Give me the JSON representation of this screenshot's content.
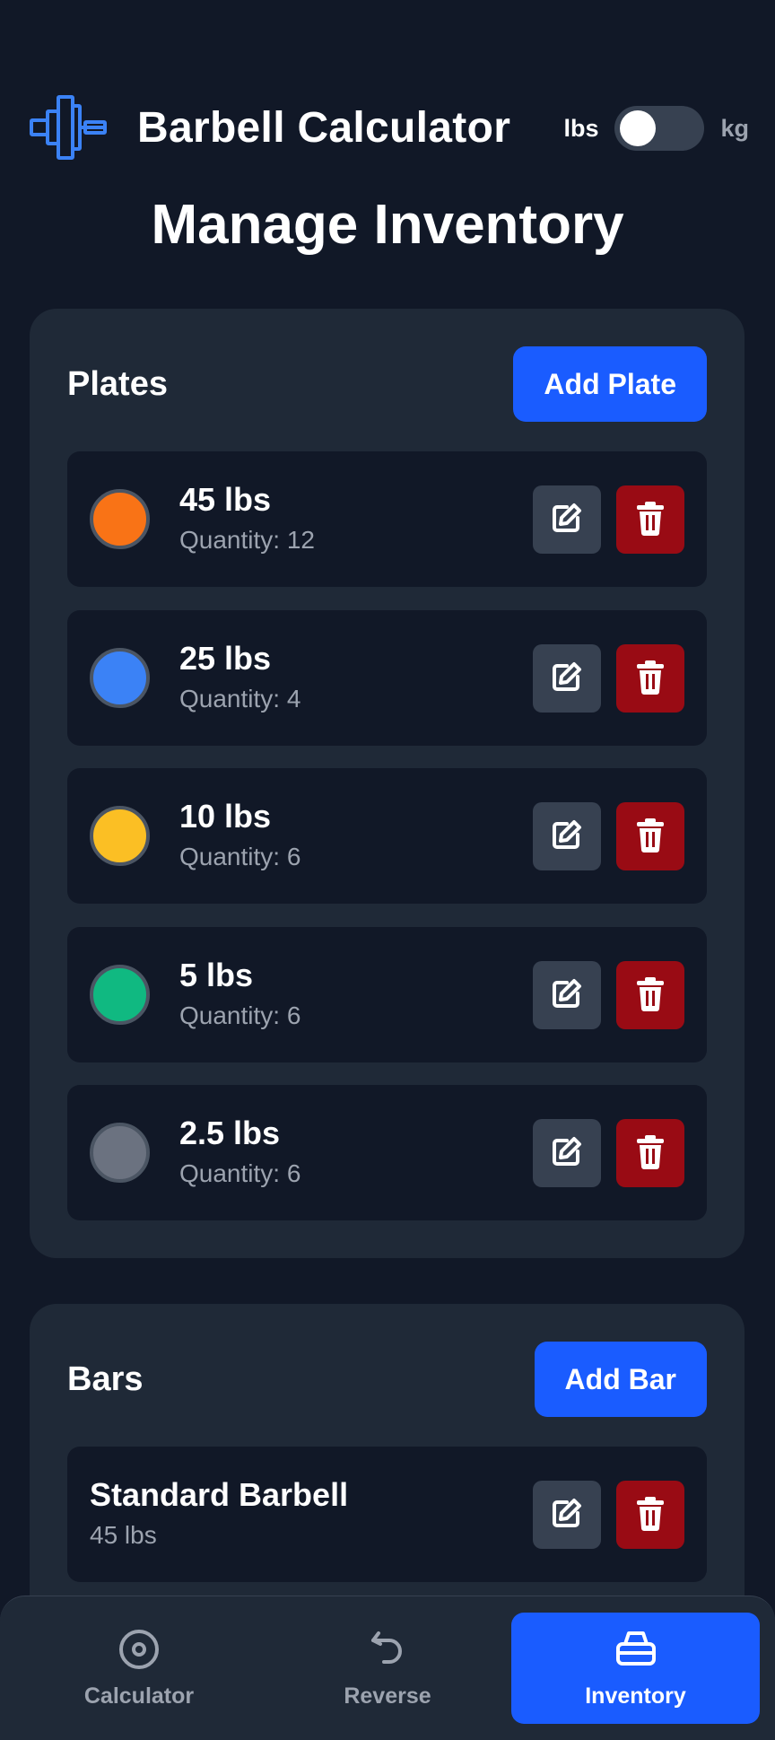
{
  "header": {
    "app_title": "Barbell Calculator",
    "unit_toggle": {
      "left_label": "lbs",
      "right_label": "kg",
      "selected": "lbs"
    }
  },
  "page_title": "Manage Inventory",
  "plates": {
    "title": "Plates",
    "add_label": "Add Plate",
    "items": [
      {
        "weight": "45 lbs",
        "quantity": "Quantity: 12",
        "color": "#f97316"
      },
      {
        "weight": "25 lbs",
        "quantity": "Quantity: 4",
        "color": "#3b82f6"
      },
      {
        "weight": "10 lbs",
        "quantity": "Quantity: 6",
        "color": "#fbbf24"
      },
      {
        "weight": "5 lbs",
        "quantity": "Quantity: 6",
        "color": "#10b981"
      },
      {
        "weight": "2.5 lbs",
        "quantity": "Quantity: 6",
        "color": "#6b7280"
      }
    ]
  },
  "bars": {
    "title": "Bars",
    "add_label": "Add Bar",
    "items": [
      {
        "name": "Standard Barbell",
        "weight": "45 lbs"
      }
    ]
  },
  "nav": {
    "items": [
      {
        "label": "Calculator",
        "icon": "target-icon"
      },
      {
        "label": "Reverse",
        "icon": "undo-arrow-icon"
      },
      {
        "label": "Inventory",
        "icon": "stack-icon",
        "active": true
      }
    ]
  },
  "colors": {
    "accent": "#1a5cff",
    "background": "#111827",
    "card": "#1f2937",
    "delete": "#990b14"
  }
}
